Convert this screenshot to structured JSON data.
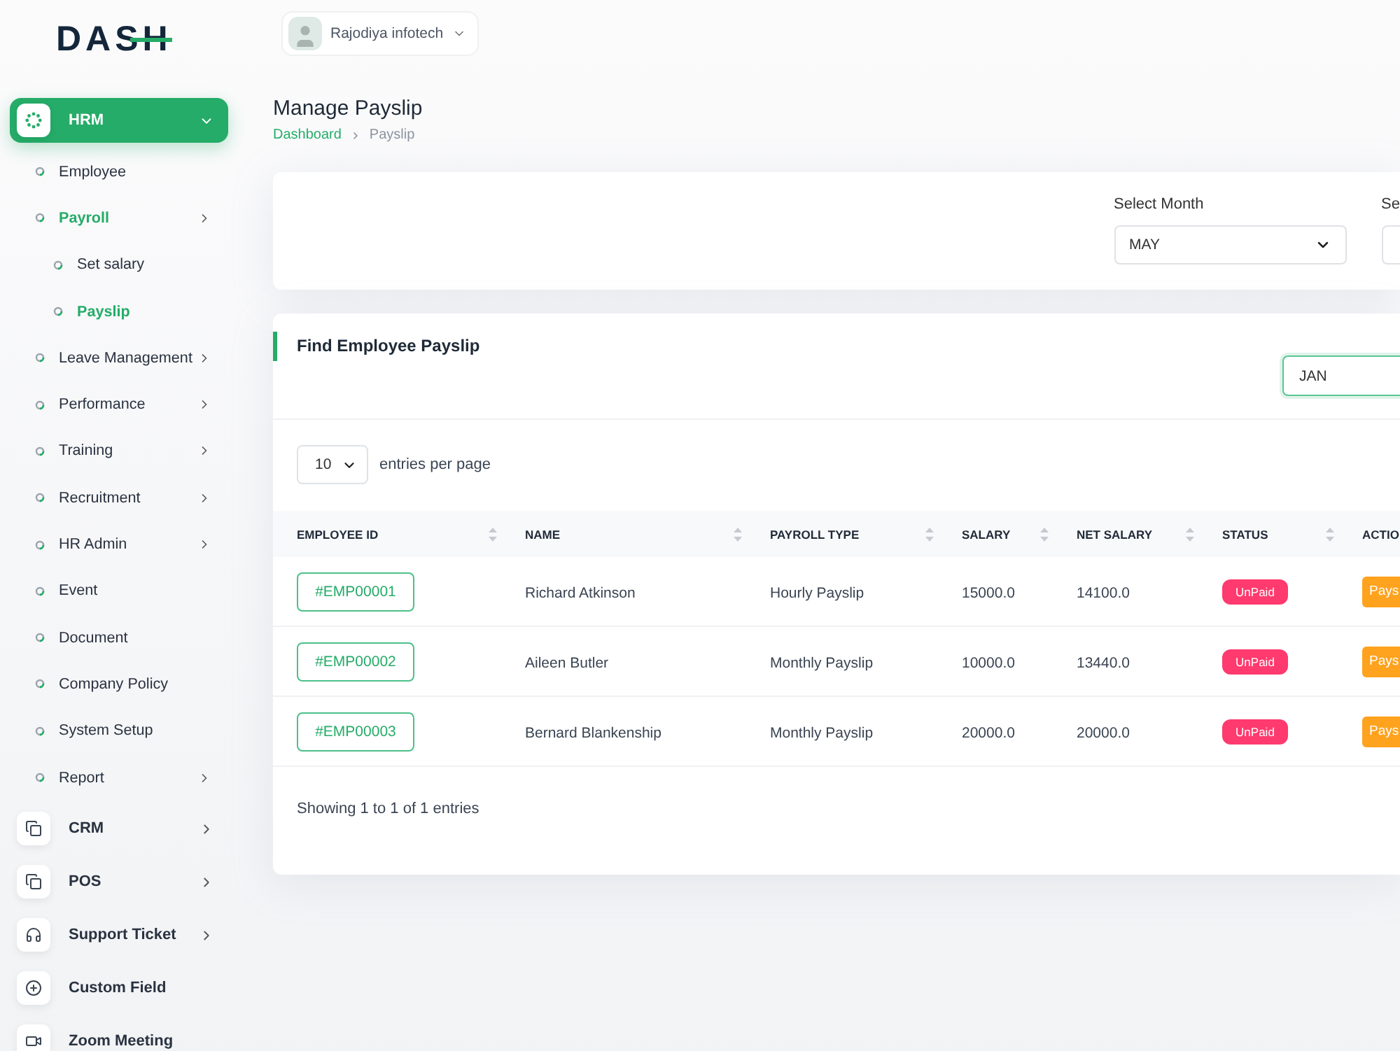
{
  "logo": "DASH",
  "user": {
    "name": "Rajodiya infotech"
  },
  "sidebar": {
    "items": [
      {
        "label": "HRM",
        "selected": true,
        "expanded": true,
        "children": [
          {
            "label": "Employee",
            "selected": false
          },
          {
            "label": "Payroll",
            "selected": true,
            "expanded": false,
            "children": [
              {
                "label": "Set salary",
                "selected": false
              },
              {
                "label": "Payslip",
                "selected": true
              }
            ]
          },
          {
            "label": "Leave Management",
            "selected": false,
            "expanded": false
          },
          {
            "label": "Performance",
            "selected": false,
            "expanded": false
          },
          {
            "label": "Training",
            "selected": false,
            "expanded": false
          },
          {
            "label": "Recruitment",
            "selected": false,
            "expanded": false
          },
          {
            "label": "HR Admin",
            "selected": false,
            "expanded": false
          },
          {
            "label": "Event",
            "selected": false
          },
          {
            "label": "Document",
            "selected": false
          },
          {
            "label": "Company Policy",
            "selected": false
          },
          {
            "label": "System Setup",
            "selected": false
          },
          {
            "label": "Report",
            "selected": false,
            "expanded": false
          }
        ]
      },
      {
        "label": "CRM",
        "selected": false,
        "expanded": false
      },
      {
        "label": "POS",
        "selected": false,
        "expanded": false
      },
      {
        "label": "Support Ticket",
        "selected": false,
        "expanded": false
      },
      {
        "label": "Custom Field",
        "selected": false
      },
      {
        "label": "Zoom Meeting",
        "selected": false
      }
    ]
  },
  "page": {
    "title": "Manage Payslip",
    "breadcrumb": [
      "Dashboard",
      "Payslip"
    ]
  },
  "filters": [
    {
      "label": "Select Month",
      "value": "MAY"
    },
    {
      "label": "Se"
    }
  ],
  "payslips": {
    "title": "Find Employee Payslip",
    "search": {
      "value": "JAN",
      "focused": true
    },
    "entries": {
      "value": "10",
      "label": "entries per page"
    },
    "columns": [
      {
        "label": "EMPLOYEE ID",
        "sortable": true
      },
      {
        "label": "NAME",
        "sortable": true
      },
      {
        "label": "PAYROLL TYPE",
        "sortable": true
      },
      {
        "label": "SALARY",
        "sortable": true
      },
      {
        "label": "NET SALARY",
        "sortable": true
      },
      {
        "label": "STATUS",
        "sortable": true
      },
      {
        "label": "ACTIO",
        "sortable": false
      }
    ],
    "rows": [
      {
        "employee_id": "#EMP00001",
        "name": "Richard Atkinson",
        "payroll_type": "Hourly Payslip",
        "salary": "15000.0",
        "net_salary": "14100.0",
        "status": "UnPaid",
        "action": "Pays"
      },
      {
        "employee_id": "#EMP00002",
        "name": "Aileen Butler",
        "payroll_type": "Monthly Payslip",
        "salary": "10000.0",
        "net_salary": "13440.0",
        "status": "UnPaid",
        "action": "Pays"
      },
      {
        "employee_id": "#EMP00003",
        "name": "Bernard Blankenship",
        "payroll_type": "Monthly Payslip",
        "salary": "20000.0",
        "net_salary": "20000.0",
        "status": "UnPaid",
        "action": "Pays"
      }
    ],
    "footer": "Showing 1 to 1 of 1 entries"
  }
}
